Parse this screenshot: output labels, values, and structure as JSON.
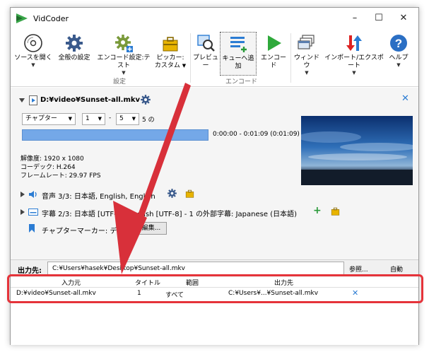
{
  "window": {
    "title": "VidCoder"
  },
  "ribbon": {
    "buttons": [
      {
        "label": "ソースを開く",
        "icon": "disc-icon"
      },
      {
        "label": "全般の設定",
        "icon": "gear-icon"
      },
      {
        "label": "エンコード設定:テスト",
        "icon": "gear-plus-icon"
      },
      {
        "label": "ピッカー:",
        "label2": "カスタム",
        "icon": "tool-box-icon"
      },
      {
        "label": "プレビュー",
        "icon": "preview-icon"
      },
      {
        "label": "キューへ追加",
        "icon": "queue-add-icon"
      },
      {
        "label": "エンコード",
        "icon": "play-icon"
      },
      {
        "label": "ウィンドウ",
        "icon": "windows-icon"
      },
      {
        "label": "インポート/エクスポート",
        "icon": "import-export-icon"
      },
      {
        "label": "ヘルプ",
        "icon": "help-icon"
      }
    ],
    "group_settings": "設定",
    "group_encode": "エンコード"
  },
  "source": {
    "path": "D:¥video¥Sunset-all.mkv",
    "range_type": "チャプター",
    "range_start": "1",
    "range_sep": "-",
    "range_end": "5",
    "range_suffix": "5 の",
    "time": "0:00:00 - 0:01:09  (0:01:09)",
    "resolution": "解像度: 1920 x 1080",
    "codec": "コーデック: H.264",
    "framerate": "フレームレート: 29.97 FPS",
    "audio": "音声 3/3: 日本語, English, English",
    "subtitle": "字幕 2/3: 日本語 [UTF-8], English [UTF-8] - 1 の外部字幕: Japanese (日本語)",
    "chapter_markers": "チャプターマーカー: デフォルト",
    "edit_button": "編集..."
  },
  "output": {
    "label": "出力先:",
    "path": "C:¥Users¥hasek¥Desktop¥Sunset-all.mkv",
    "browse": "参照...",
    "auto": "自動"
  },
  "queue": {
    "headers": [
      "入力元",
      "タイトル",
      "範囲",
      "出力先"
    ],
    "rows": [
      {
        "source": "D:¥video¥Sunset-all.mkv",
        "title": "1",
        "range": "すべて",
        "dest": "C:¥Users¥...¥Sunset-all.mkv"
      }
    ],
    "remove": "✕"
  },
  "colors": {
    "accent": "#2b7cd3",
    "timeline": "#74a8e8",
    "annotation": "#e5333a"
  }
}
